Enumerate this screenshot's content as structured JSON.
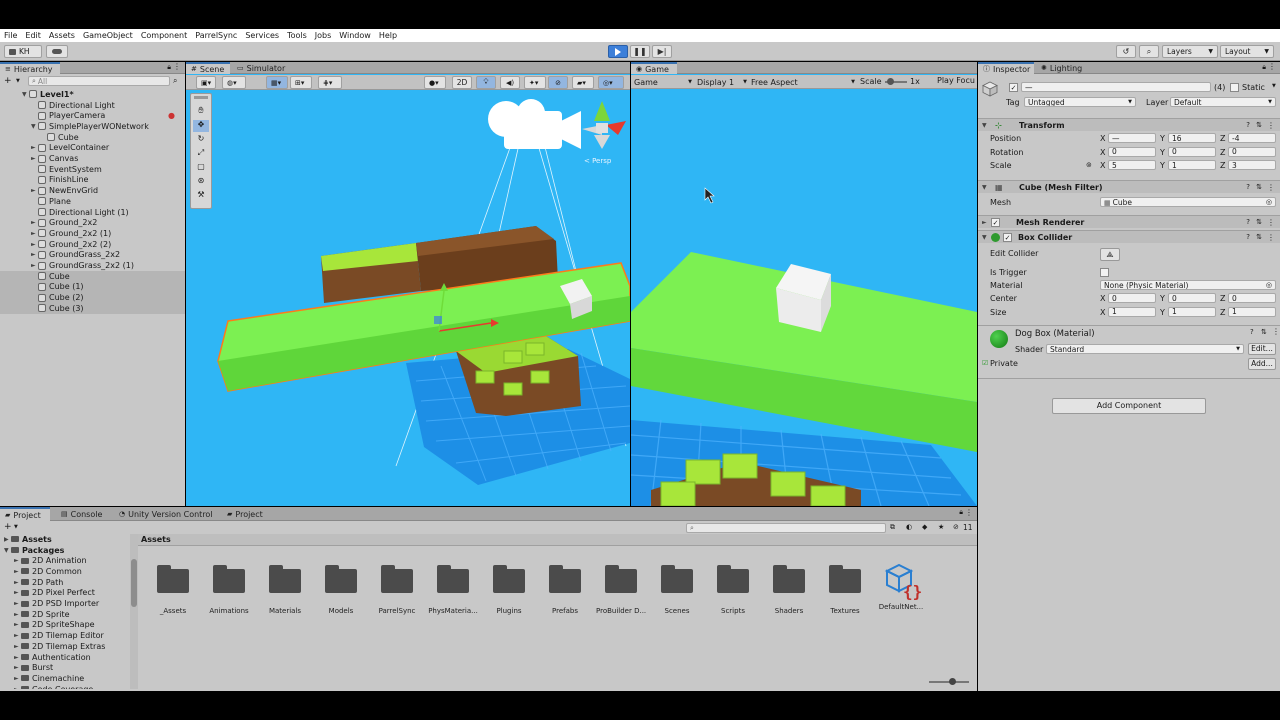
{
  "menu": [
    "File",
    "Edit",
    "Assets",
    "GameObject",
    "Component",
    "ParrelSync",
    "Services",
    "Tools",
    "Jobs",
    "Window",
    "Help"
  ],
  "toolbar": {
    "account": "KH",
    "layers_label": "Layers",
    "layout_label": "Layout"
  },
  "hierarchy": {
    "tab": "Hierarchy",
    "search_placeholder": "All",
    "items": [
      {
        "label": "Level1*",
        "depth": 0,
        "bold": true,
        "fold": "▼"
      },
      {
        "label": "Directional Light",
        "depth": 1
      },
      {
        "label": "PlayerCamera",
        "depth": 1
      },
      {
        "label": "SimplePlayerWONetwork",
        "depth": 1,
        "fold": "▼"
      },
      {
        "label": "Cube",
        "depth": 2
      },
      {
        "label": "LevelContainer",
        "depth": 1,
        "fold": "►"
      },
      {
        "label": "Canvas",
        "depth": 1,
        "fold": "►"
      },
      {
        "label": "EventSystem",
        "depth": 1
      },
      {
        "label": "FinishLine",
        "depth": 1
      },
      {
        "label": "NewEnvGrid",
        "depth": 1,
        "fold": "►"
      },
      {
        "label": "Plane",
        "depth": 1
      },
      {
        "label": "Directional Light (1)",
        "depth": 1
      },
      {
        "label": "Ground_2x2",
        "depth": 1,
        "fold": "►"
      },
      {
        "label": "Ground_2x2 (1)",
        "depth": 1,
        "fold": "►"
      },
      {
        "label": "Ground_2x2 (2)",
        "depth": 1,
        "fold": "►"
      },
      {
        "label": "GroundGrass_2x2",
        "depth": 1,
        "fold": "►"
      },
      {
        "label": "GroundGrass_2x2 (1)",
        "depth": 1,
        "fold": "►"
      },
      {
        "label": "Cube",
        "depth": 1,
        "sel": true
      },
      {
        "label": "Cube (1)",
        "depth": 1,
        "sel": true
      },
      {
        "label": "Cube (2)",
        "depth": 1,
        "sel": true
      },
      {
        "label": "Cube (3)",
        "depth": 1,
        "sel": true
      }
    ]
  },
  "scene": {
    "tabs": [
      "Scene",
      "Simulator"
    ],
    "mode_2d": "2D",
    "persp_label": "< Persp"
  },
  "game": {
    "tab": "Game",
    "mode": "Game",
    "display": "Display 1",
    "aspect": "Free Aspect",
    "scale_label": "Scale",
    "scale_value": "1x",
    "play_focused": "Play Focu"
  },
  "inspector": {
    "tabs": [
      "Inspector",
      "Lighting"
    ],
    "name_value": "—",
    "count": "(4)",
    "static_label": "Static",
    "tag_label": "Tag",
    "tag_value": "Untagged",
    "layer_label": "Layer",
    "layer_value": "Default",
    "transform": {
      "title": "Transform",
      "position_label": "Position",
      "rotation_label": "Rotation",
      "scale_label": "Scale",
      "position": {
        "x": "—",
        "y": "16",
        "z": "-4"
      },
      "rotation": {
        "x": "0",
        "y": "0",
        "z": "0"
      },
      "scale": {
        "x": "5",
        "y": "1",
        "z": "3"
      }
    },
    "mesh_filter": {
      "title": "Cube (Mesh Filter)",
      "mesh_label": "Mesh",
      "mesh_value": "Cube"
    },
    "mesh_renderer": {
      "title": "Mesh Renderer"
    },
    "box_collider": {
      "title": "Box Collider",
      "edit_label": "Edit Collider",
      "trigger_label": "Is Trigger",
      "material_label": "Material",
      "material_value": "None (Physic Material)",
      "center_label": "Center",
      "size_label": "Size",
      "center": {
        "x": "0",
        "y": "0",
        "z": "0"
      },
      "size": {
        "x": "1",
        "y": "1",
        "z": "1"
      }
    },
    "material": {
      "title": "Dog Box (Material)",
      "shader_label": "Shader",
      "shader_value": "Standard",
      "edit_label": "Edit...",
      "private_label": "Private",
      "add_label": "Add..."
    },
    "add_component": "Add Component",
    "axis": {
      "x": "X",
      "y": "Y",
      "z": "Z"
    }
  },
  "bottom": {
    "tabs": [
      "Project",
      "Console",
      "Unity Version Control",
      "Project"
    ],
    "hidden_count": "11",
    "assets_header": "Assets",
    "tree": [
      {
        "label": "Assets",
        "depth": 0,
        "bold": true,
        "fold": "▶"
      },
      {
        "label": "Packages",
        "depth": 0,
        "bold": true,
        "fold": "▼"
      },
      {
        "label": "2D Animation",
        "depth": 1,
        "fold": "►"
      },
      {
        "label": "2D Common",
        "depth": 1,
        "fold": "►"
      },
      {
        "label": "2D Path",
        "depth": 1,
        "fold": "►"
      },
      {
        "label": "2D Pixel Perfect",
        "depth": 1,
        "fold": "►"
      },
      {
        "label": "2D PSD Importer",
        "depth": 1,
        "fold": "►"
      },
      {
        "label": "2D Sprite",
        "depth": 1,
        "fold": "►"
      },
      {
        "label": "2D SpriteShape",
        "depth": 1,
        "fold": "►"
      },
      {
        "label": "2D Tilemap Editor",
        "depth": 1,
        "fold": "►"
      },
      {
        "label": "2D Tilemap Extras",
        "depth": 1,
        "fold": "►"
      },
      {
        "label": "Authentication",
        "depth": 1,
        "fold": "►"
      },
      {
        "label": "Burst",
        "depth": 1,
        "fold": "►"
      },
      {
        "label": "Cinemachine",
        "depth": 1,
        "fold": "►"
      },
      {
        "label": "Code Coverage",
        "depth": 1,
        "fold": "►"
      }
    ],
    "folders": [
      "_Assets",
      "Animations",
      "Materials",
      "Models",
      "ParrelSync",
      "PhysMateria...",
      "Plugins",
      "Prefabs",
      "ProBuilder D...",
      "Scenes",
      "Scripts",
      "Shaders",
      "Textures"
    ],
    "script_asset": "DefaultNet..."
  },
  "colors": {
    "sky": "#2fb6f5",
    "platform": "#7cf052",
    "selection_outline": "#ff7a1a",
    "play_active": "#3c7fd9"
  }
}
